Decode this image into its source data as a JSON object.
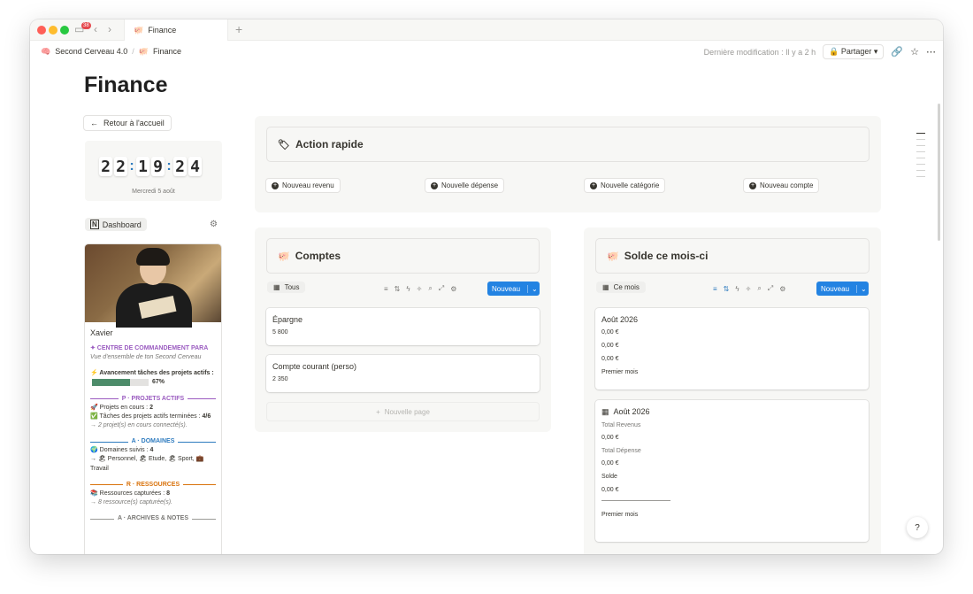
{
  "titlebar": {
    "badge": "38",
    "tab_title": "Finance",
    "new_tab": "+"
  },
  "navbar": {
    "workspace": "Second Cerveau 4.0",
    "page": "Finance",
    "last_modified": "Dernière modification : Il y a 2 h",
    "share": "Partager"
  },
  "page": {
    "title": "Finance",
    "back_button": "Retour à l'accueil"
  },
  "clock": {
    "digits": [
      "2",
      "2",
      "1",
      "9",
      "2",
      "4"
    ],
    "date": "Mercredi 5 août"
  },
  "dashboard": {
    "label": "Dashboard"
  },
  "profile": {
    "name": "Xavier",
    "command_title": "✦ CENTRE DE COMMANDEMENT PARA",
    "command_sub": "Vue d'ensemble de ton Second Cerveau",
    "progress_label": "⚡ Avancement tâches des projets actifs :",
    "progress_value": "67%",
    "progress_fraction": 0.67,
    "projects_head": "P · PROJETS ACTIFS",
    "projects_in_progress_label": "🚀 Projets en cours :",
    "projects_in_progress_value": "2",
    "projects_tasks_label": "✅ Tâches des projets actifs terminées :",
    "projects_tasks_value": "4/6",
    "projects_connected": "→ 2 projet(s) en cours connecté(s).",
    "domains_head": "A · DOMAINES",
    "domains_label": "🌍 Domaines suivis :",
    "domains_value": "4",
    "domains_list": "→ 🏖 Personnel, 🏖 Etude, 🏖 Sport, 💼 Travail",
    "resources_head": "R · RESSOURCES",
    "resources_label": "📚 Ressources capturées :",
    "resources_value": "8",
    "resources_sub": "→ 8 ressource(s) capturée(s).",
    "archives_head": "A · ARCHIVES & NOTES"
  },
  "quick_action": {
    "title": "Action rapide",
    "buttons": [
      "Nouveau revenu",
      "Nouvelle dépense",
      "Nouvelle catégorie",
      "Nouveau compte"
    ]
  },
  "accounts": {
    "title": "Comptes",
    "view": "Tous",
    "new_button": "Nouveau",
    "cards": [
      {
        "title": "Épargne",
        "value": "5 800"
      },
      {
        "title": "Compte courant (perso)",
        "value": "2 350"
      }
    ],
    "new_page": "Nouvelle page"
  },
  "balance": {
    "title": "Solde ce mois-ci",
    "view": "Ce mois",
    "new_button": "Nouveau",
    "card1": {
      "title": "Août 2026",
      "values": [
        "0,00 €",
        "0,00 €",
        "0,00 €"
      ],
      "footer": "Premier mois"
    },
    "card2": {
      "title": "Août 2026",
      "revenue_label": "Total Revenus",
      "revenue_value": "0,00 €",
      "expense_label": "Total Dépense",
      "expense_value": "0,00 €",
      "balance_label": "Solde",
      "balance_value": "0,00 €",
      "footer": "Premier mois"
    }
  },
  "help": {
    "label": "?"
  }
}
